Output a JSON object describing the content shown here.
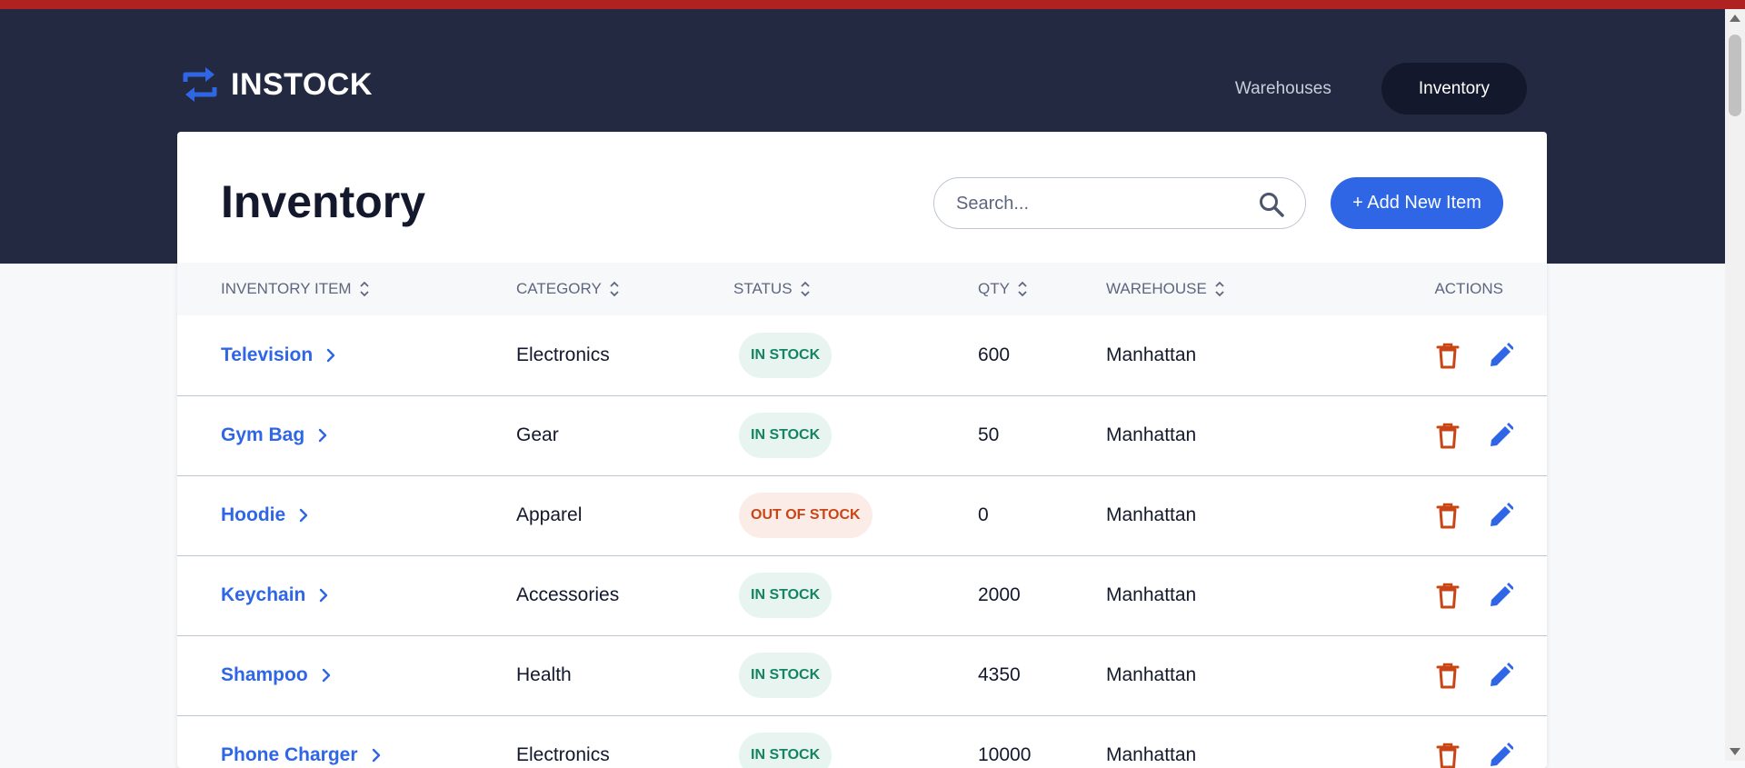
{
  "app": {
    "name": "INSTOCK"
  },
  "nav": {
    "items": [
      {
        "label": "Warehouses",
        "active": false
      },
      {
        "label": "Inventory",
        "active": true
      }
    ]
  },
  "page": {
    "title": "Inventory",
    "search_placeholder": "Search...",
    "add_button": "+ Add New Item"
  },
  "table": {
    "columns": [
      "INVENTORY ITEM",
      "CATEGORY",
      "STATUS",
      "QTY",
      "WAREHOUSE",
      "ACTIONS"
    ],
    "rows": [
      {
        "item": "Television",
        "category": "Electronics",
        "status": "IN STOCK",
        "qty": "600",
        "warehouse": "Manhattan"
      },
      {
        "item": "Gym Bag",
        "category": "Gear",
        "status": "IN STOCK",
        "qty": "50",
        "warehouse": "Manhattan"
      },
      {
        "item": "Hoodie",
        "category": "Apparel",
        "status": "OUT OF STOCK",
        "qty": "0",
        "warehouse": "Manhattan"
      },
      {
        "item": "Keychain",
        "category": "Accessories",
        "status": "IN STOCK",
        "qty": "2000",
        "warehouse": "Manhattan"
      },
      {
        "item": "Shampoo",
        "category": "Health",
        "status": "IN STOCK",
        "qty": "4350",
        "warehouse": "Manhattan"
      },
      {
        "item": "Phone Charger",
        "category": "Electronics",
        "status": "IN STOCK",
        "qty": "10000",
        "warehouse": "Manhattan"
      }
    ]
  },
  "colors": {
    "header_bg": "#232940",
    "accent": "#2e66e6",
    "in_stock_text": "#158463",
    "in_stock_bg": "#e7f4ef",
    "out_stock_text": "#c94516",
    "out_stock_bg": "#fbece8",
    "delete_icon": "#c94516",
    "top_strip": "#b02222"
  }
}
